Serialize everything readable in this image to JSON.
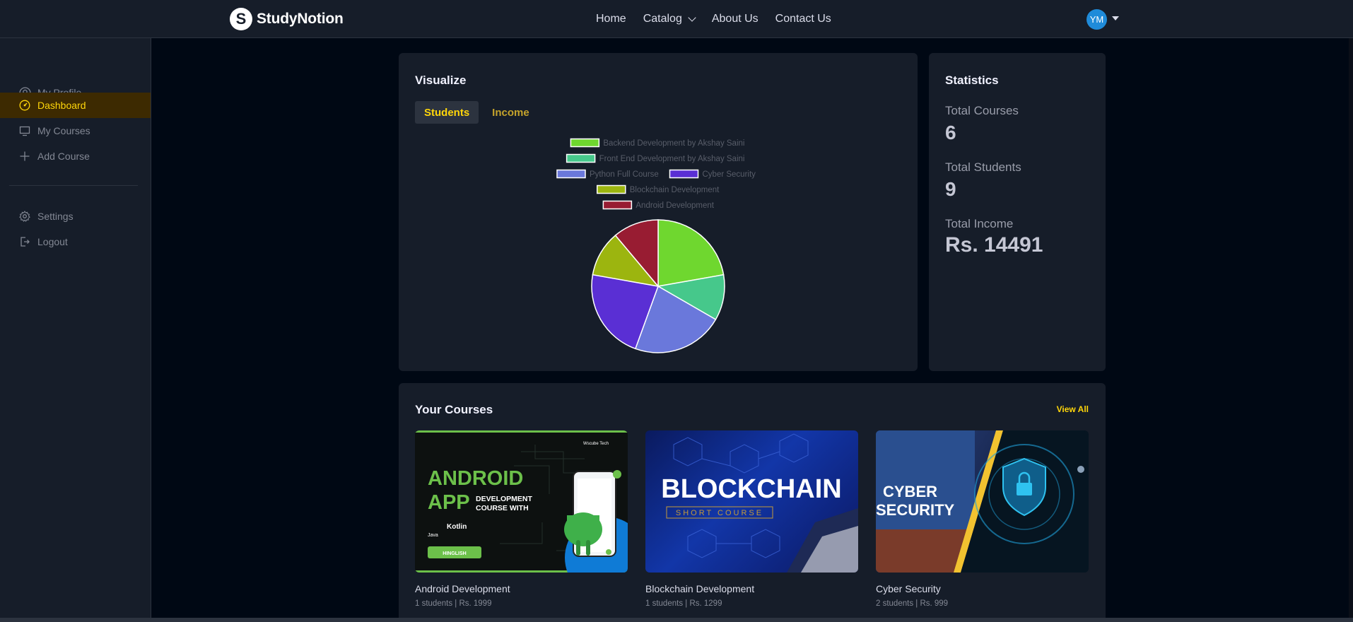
{
  "navbar": {
    "logo_text": "StudyNotion",
    "logo_letter": "S",
    "links": [
      "Home",
      "Catalog",
      "About Us",
      "Contact Us"
    ],
    "avatar_initials": "YM"
  },
  "sidebar": {
    "items": [
      {
        "label": "My Profile",
        "icon": "user-icon"
      },
      {
        "label": "Dashboard",
        "icon": "dashboard-icon",
        "active": true
      },
      {
        "label": "My Courses",
        "icon": "monitor-icon"
      },
      {
        "label": "Add Course",
        "icon": "plus-icon"
      }
    ],
    "bottom_items": [
      {
        "label": "Settings",
        "icon": "gear-icon"
      },
      {
        "label": "Logout",
        "icon": "logout-icon"
      }
    ]
  },
  "visualize": {
    "title": "Visualize",
    "tabs": [
      "Students",
      "Income"
    ],
    "active_tab": "Students"
  },
  "chart_data": {
    "type": "pie",
    "legend_position": "top",
    "series": [
      {
        "name": "Backend Development by Akshay Saini",
        "value": 2,
        "color": "#6fd72f"
      },
      {
        "name": "Front End Development by Akshay Saini",
        "value": 1,
        "color": "#46c88b"
      },
      {
        "name": "Python Full Course",
        "value": 2,
        "color": "#6a78db"
      },
      {
        "name": "Cyber Security",
        "value": 2,
        "color": "#5a2fd4"
      },
      {
        "name": "Blockchain Development",
        "value": 1,
        "color": "#9cb50f"
      },
      {
        "name": "Android Development",
        "value": 1,
        "color": "#981c32"
      }
    ]
  },
  "statistics": {
    "title": "Statistics",
    "total_courses_label": "Total Courses",
    "total_courses": "6",
    "total_students_label": "Total Students",
    "total_students": "9",
    "total_income_label": "Total Income",
    "total_income": "Rs. 14491"
  },
  "courses": {
    "title": "Your Courses",
    "view_all": "View All",
    "items": [
      {
        "name": "Android Development",
        "meta": "1 students  |  Rs. 1999"
      },
      {
        "name": "Blockchain Development",
        "meta": "1 students  |  Rs. 1299"
      },
      {
        "name": "Cyber Security",
        "meta": "2 students  |  Rs. 999"
      }
    ],
    "thumbnails": {
      "android": {
        "line1": "ANDROID",
        "line2": "APP",
        "line3": "DEVELOPMENT",
        "line4": "COURSE WITH",
        "java": "Java",
        "kotlin": "Kotlin",
        "badge": "HINGLISH",
        "brand": "Wscube Tech"
      },
      "blockchain": {
        "title": "BLOCKCHAIN",
        "subtitle": "SHORT COURSE"
      },
      "cyber": {
        "line1": "CYBER",
        "line2": "SECURITY"
      }
    }
  }
}
